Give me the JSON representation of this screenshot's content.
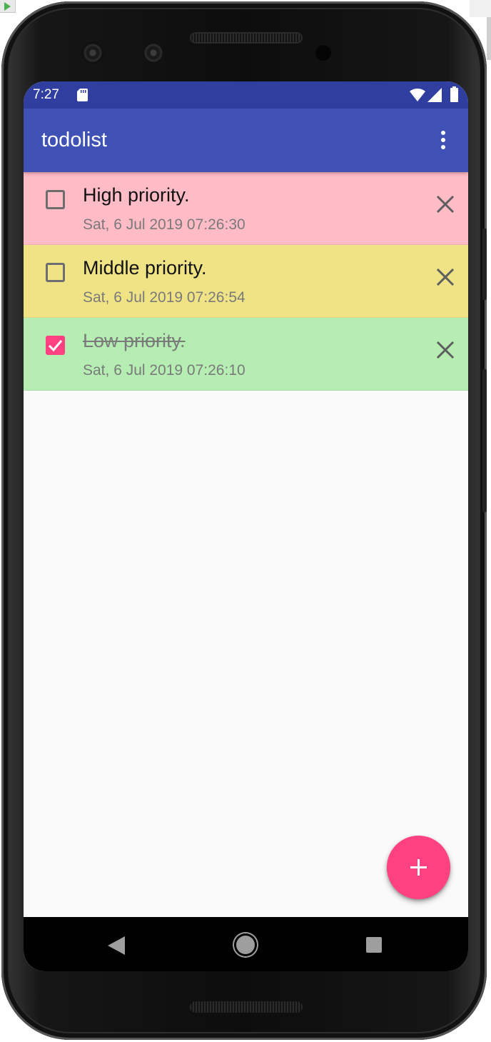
{
  "status_bar": {
    "time": "7:27",
    "icons": [
      "sd-card-icon",
      "wifi-icon",
      "signal-icon",
      "battery-icon"
    ]
  },
  "app_bar": {
    "title": "todolist",
    "overflow_icon": "more-vert-icon",
    "background": "#3f51b5"
  },
  "todos": [
    {
      "title": "High priority.",
      "date": "Sat, 6 Jul 2019 07:26:30",
      "checked": false,
      "color": "#ffbbc6"
    },
    {
      "title": "Middle priority.",
      "date": "Sat, 6 Jul 2019 07:26:54",
      "checked": false,
      "color": "#efe386"
    },
    {
      "title": "Low priority.",
      "date": "Sat, 6 Jul 2019 07:26:10",
      "checked": true,
      "color": "#b5edb3"
    }
  ],
  "fab": {
    "icon": "add-icon",
    "color": "#ff4081"
  },
  "nav_bar": {
    "icons": [
      "back-icon",
      "home-icon",
      "recents-icon"
    ]
  },
  "colors": {
    "status_bar": "#303f9f",
    "accent": "#ff4081"
  }
}
